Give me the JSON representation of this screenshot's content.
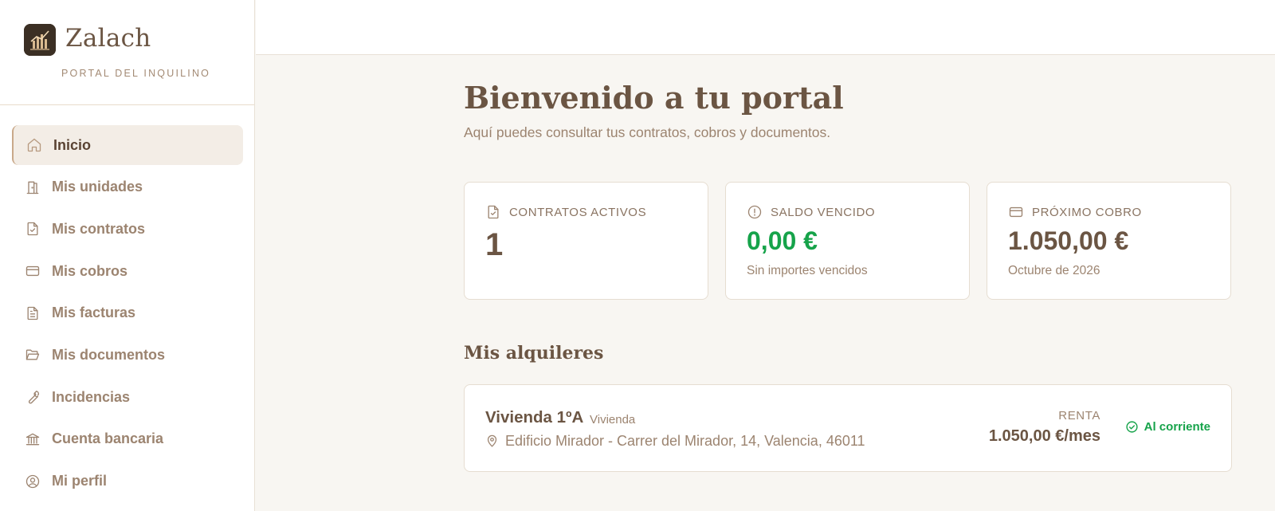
{
  "brand": {
    "name": "Zalach",
    "subtitle": "PORTAL DEL INQUILINO"
  },
  "sidebar": {
    "items": [
      {
        "label": "Inicio",
        "icon": "home-icon",
        "active": true
      },
      {
        "label": "Mis unidades",
        "icon": "door-icon"
      },
      {
        "label": "Mis contratos",
        "icon": "file-check-icon"
      },
      {
        "label": "Mis cobros",
        "icon": "credit-card-icon"
      },
      {
        "label": "Mis facturas",
        "icon": "file-text-icon"
      },
      {
        "label": "Mis documentos",
        "icon": "folder-open-icon"
      },
      {
        "label": "Incidencias",
        "icon": "wrench-icon"
      },
      {
        "label": "Cuenta bancaria",
        "icon": "bank-icon"
      },
      {
        "label": "Mi perfil",
        "icon": "user-circle-icon"
      }
    ]
  },
  "main": {
    "title": "Bienvenido a tu portal",
    "subtitle": "Aquí puedes consultar tus contratos, cobros y documentos.",
    "stats": [
      {
        "label": "CONTRATOS ACTIVOS",
        "value": "1",
        "icon": "file-check-icon"
      },
      {
        "label": "SALDO VENCIDO",
        "value": "0,00 €",
        "note": "Sin importes vencidos",
        "icon": "alert-circle-icon",
        "value_color": "#16a34a"
      },
      {
        "label": "PRÓXIMO COBRO",
        "value": "1.050,00 €",
        "note": "Octubre de 2026",
        "icon": "credit-card-icon"
      }
    ],
    "rentals_title": "Mis alquileres",
    "rental": {
      "name": "Vivienda 1ºA",
      "type": "Vivienda",
      "address": "Edificio Mirador - Carrer del Mirador, 14, Valencia, 46011",
      "rent_label": "RENTA",
      "rent_amount": "1.050,00 €/mes",
      "status": "Al corriente",
      "status_color": "#16a34a"
    }
  },
  "colors": {
    "brand_text": "#6b5543",
    "muted": "#9c8470",
    "accent_border": "#c9a98a",
    "success": "#16a34a",
    "background": "#f8f6f2"
  }
}
